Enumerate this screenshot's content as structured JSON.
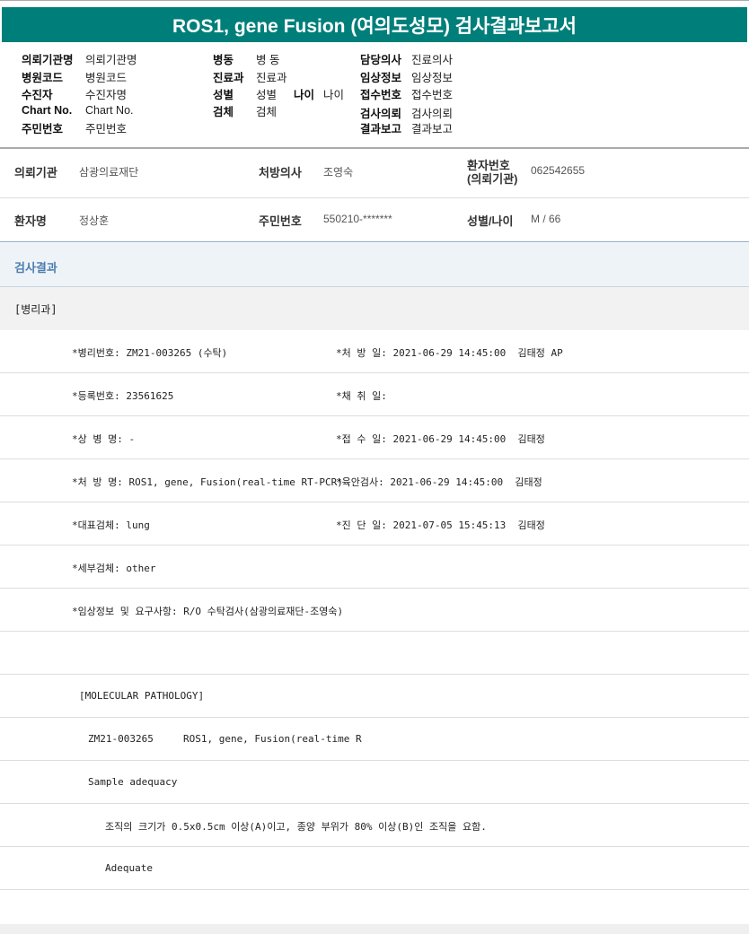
{
  "title": "ROS1, gene Fusion (여의도성모) 검사결과보고서",
  "info": {
    "c1": [
      [
        "의뢰기관명",
        "의뢰기관명"
      ],
      [
        "병원코드",
        "병원코드"
      ],
      [
        "수진자",
        "수진자명"
      ],
      [
        "Chart No.",
        "Chart No."
      ],
      [
        "주민번호",
        "주민번호"
      ]
    ],
    "c2": [
      [
        "병동",
        "병 동"
      ],
      [
        "진료과",
        "진료과"
      ],
      [
        "성별",
        "성별"
      ],
      [
        "검체",
        "검체"
      ]
    ],
    "age": [
      "나이",
      "나이"
    ],
    "c3": [
      [
        "담당의사",
        "진료의사"
      ],
      [
        "임상정보",
        "임상정보"
      ],
      [
        "접수번호",
        "접수번호"
      ],
      [
        "검사의뢰",
        "검사의뢰"
      ],
      [
        "결과보고",
        "결과보고"
      ]
    ]
  },
  "patient": {
    "org_label": "의뢰기관",
    "org": "삼광의료재단",
    "doctor_label": "처방의사",
    "doctor": "조영숙",
    "pid_label1": "환자번호",
    "pid_label2": "(의뢰기관)",
    "pid": "062542655",
    "name_label": "환자명",
    "name": "정상훈",
    "rrn_label": "주민번호",
    "rrn": "550210-*******",
    "sexage_label": "성별/나이",
    "sexage": "M / 66"
  },
  "section": "검사결과",
  "dept": "[병리과]",
  "rows": [
    [
      "*병리번호: ZM21-003265 (수탁)",
      "*처 방 일: 2021-06-29 14:45:00  김태정 AP"
    ],
    [
      "*등록번호: 23561625",
      "*채 취 일:"
    ],
    [
      "*상 병 명: -",
      "*접 수 일: 2021-06-29 14:45:00  김태정"
    ],
    [
      "*처 방 명: ROS1, gene, Fusion(real-time RT-PCR)",
      "*육안검사: 2021-06-29 14:45:00  김태정"
    ],
    [
      "*대표검체: lung",
      "*진 단 일: 2021-07-05 15:45:13  김태정"
    ],
    [
      "*세부검체: other",
      ""
    ],
    [
      "*임상정보 및 요구사항: R/O 수탁검사(삼광의료재단-조영숙)",
      ""
    ]
  ],
  "molecular": {
    "header": "[MOLECULAR PATHOLOGY]",
    "test_line": "ZM21-003265     ROS1, gene, Fusion(real-time R",
    "adequacy": "Sample adequacy",
    "criteria": "조직의 크기가 0.5x0.5cm 이상(A)이고, 종양 부위가 80% 이상(B)인 조직을 요함.",
    "result": "Adequate"
  }
}
